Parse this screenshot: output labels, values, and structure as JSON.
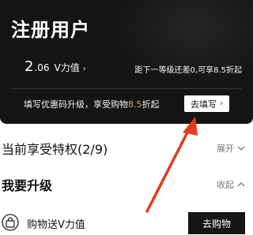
{
  "card": {
    "title": "注册用户",
    "value_int": "2",
    "value_dec": ".06",
    "value_label": "V力值",
    "value_chevron": "›",
    "next_level_text": "距下一等级还差0,可享8.5折起",
    "coupon_prefix": "填写优惠码升级，享受购物",
    "coupon_accent": "8.5",
    "coupon_suffix": "折起",
    "fill_button_label": "去填写",
    "fill_button_chevron": "›"
  },
  "privilege": {
    "label": "当前享受特权(2/9)",
    "toggle_label": "展开",
    "toggle_icon": "chevron-down-icon"
  },
  "upgrade": {
    "label": "我要升级",
    "toggle_label": "收起",
    "toggle_icon": "chevron-up-icon"
  },
  "task": {
    "icon": "shopping-bag-icon",
    "label": "购物送V力值",
    "button_label": "去购物"
  },
  "colors": {
    "card_bg": "#151515",
    "accent_gold": "#d9a55a",
    "arrow_red": "#e8391f"
  }
}
